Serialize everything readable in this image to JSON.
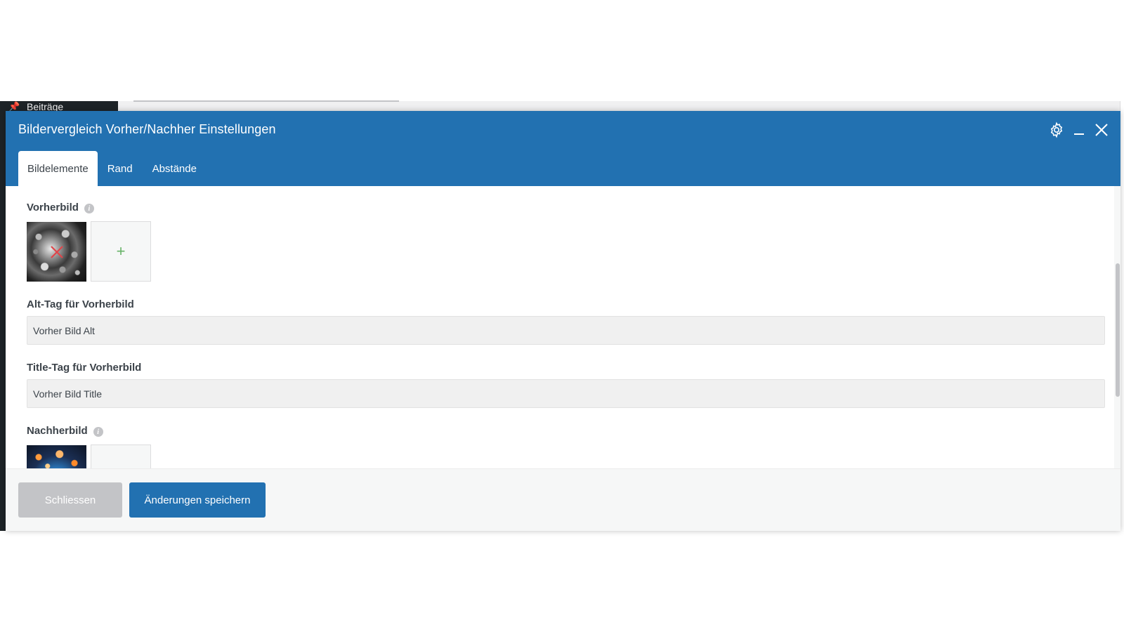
{
  "admin": {
    "menu_item_label": "Beiträge"
  },
  "modal": {
    "title": "Bildervergleich Vorher/Nachher Einstellungen",
    "tabs": [
      {
        "label": "Bildelemente",
        "active": true
      },
      {
        "label": "Rand",
        "active": false
      },
      {
        "label": "Abstände",
        "active": false
      }
    ],
    "header_icons": [
      "gear-icon",
      "minimize-icon",
      "close-icon"
    ]
  },
  "fields": {
    "before_image": {
      "label": "Vorherbild",
      "add_symbol": "+"
    },
    "before_alt": {
      "label": "Alt-Tag für Vorherbild",
      "value": "Vorher Bild Alt"
    },
    "before_title": {
      "label": "Title-Tag für Vorherbild",
      "value": "Vorher Bild Title"
    },
    "after_image": {
      "label": "Nachherbild"
    }
  },
  "footer": {
    "close_label": "Schliessen",
    "save_label": "Änderungen speichern"
  },
  "colors": {
    "primary": "#2271b1",
    "close_button": "#c3c4c7",
    "add_plus": "#68b368",
    "remove_x": "#e0454a"
  }
}
